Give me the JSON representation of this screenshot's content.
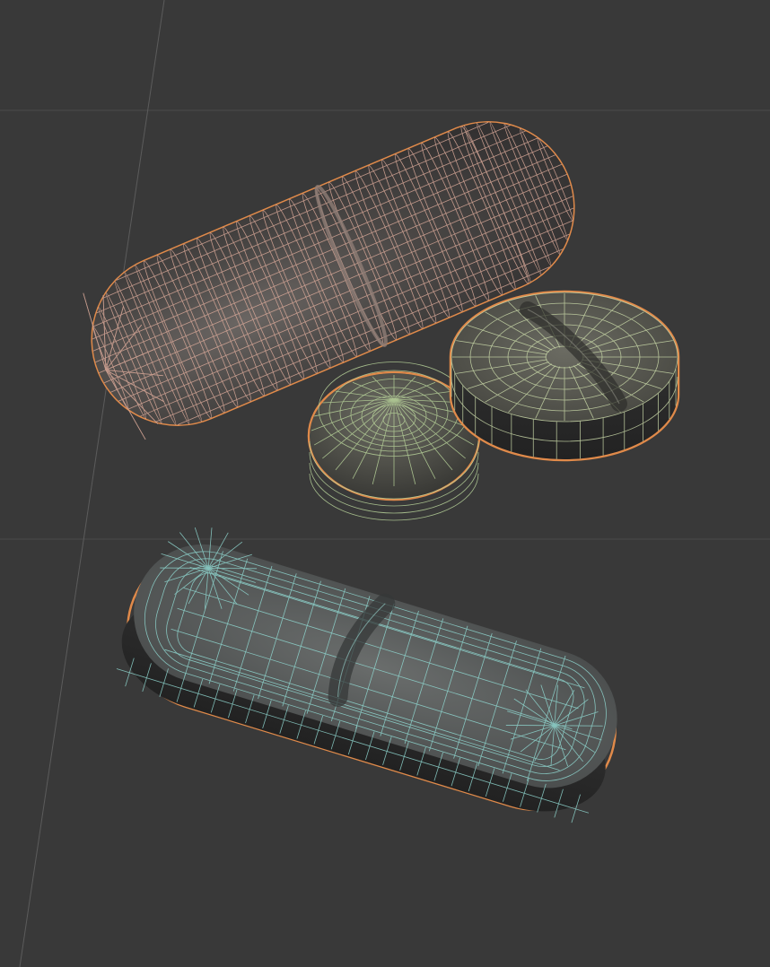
{
  "viewport": {
    "background": "#393939",
    "grid_line_color": "#4a4a4a",
    "axis_line_color": "#5c5c5c"
  },
  "objects": [
    {
      "name": "capsule",
      "wire_color": "#d8a898",
      "outline_color": "#e08a4a",
      "selected": true
    },
    {
      "name": "round-tablet",
      "wire_color": "#b8d39a",
      "outline_color": "#e08a4a",
      "selected": true
    },
    {
      "name": "scored-disc-tablet",
      "wire_color": "#c9d8a8",
      "outline_color": "#e08a4a",
      "selected": true
    },
    {
      "name": "scored-oblong-tablet",
      "wire_color": "#8fd6cf",
      "outline_color": "#e08a4a",
      "selected": true
    }
  ]
}
